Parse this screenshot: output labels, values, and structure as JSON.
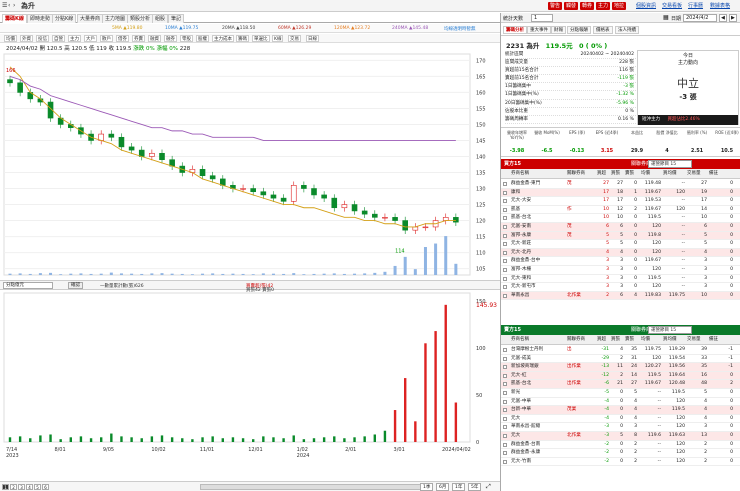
{
  "app": {
    "title": "為升",
    "nav_icons": [
      "menu-icon",
      "back-icon",
      "forward-icon"
    ]
  },
  "top_actions": [
    {
      "label": "警告",
      "color": "#c00"
    },
    {
      "label": "觸發",
      "color": "#c00"
    },
    {
      "label": "轉券",
      "color": "#c00"
    },
    {
      "label": "主力",
      "color": "#c00"
    },
    {
      "label": "地拉",
      "color": "#c00"
    }
  ],
  "top_links": [
    "個股資訊",
    "交易看板",
    "行事曆",
    "數據表格"
  ],
  "tabs": [
    "籌碼K線",
    "即時走勢",
    "分點K線",
    "大量券商",
    "主力地圖",
    "類股分析",
    "組股",
    "筆記"
  ],
  "ma_legend": [
    {
      "label": "5MA ▲119.80",
      "color": "#d4a017"
    },
    {
      "label": "10MA ▲119.75",
      "color": "#2a7fd4"
    },
    {
      "label": "20MA ▲118.50",
      "color": "#444"
    },
    {
      "label": "60MA ▲126.29",
      "color": "#c0392b"
    },
    {
      "label": "120MA ▲123.72",
      "color": "#e67e22"
    },
    {
      "label": "240MA ▲145.48",
      "color": "#9b59b6"
    }
  ],
  "ma_note": "均線透明時暫無",
  "toolbar": [
    "均價",
    "外資",
    "投信",
    "自營",
    "主力",
    "大戶",
    "散戶",
    "借券",
    "券賣",
    "融資",
    "融券",
    "零股",
    "股權",
    "主力成本",
    "籌碼",
    "單邊比",
    "K線",
    "交易",
    "日",
    "週",
    "月",
    "年",
    "還原",
    "切換",
    "日線"
  ],
  "info_line": {
    "date": "2024/04/02",
    "open_label": "開",
    "open": "120.5",
    "high_label": "高",
    "high": "120.5",
    "low_label": "低",
    "low": "119",
    "close_label": "收",
    "close": "119.5",
    "chg_label": "漲跌",
    "chg": "0%",
    "chg_pct_label": "漲幅",
    "chg_pct": "0%",
    "vol": "228"
  },
  "price_axis": [
    "170",
    "165",
    "160",
    "155",
    "150",
    "145",
    "140",
    "135",
    "130",
    "125",
    "120",
    "115",
    "110",
    "105"
  ],
  "price_marks": {
    "hi": "166",
    "lo": "114"
  },
  "indicator_bar": {
    "select": "分點億元",
    "button": "確認",
    "legend1": "一數量累計數(張)626",
    "legend2": "買賣超(張)42",
    "legend3": "買張42 賣張0"
  },
  "volume_axis": [
    "150",
    "100",
    "50",
    "0"
  ],
  "volume_marker": "145.93",
  "x_axis": [
    "7/14\n2023",
    "8/01",
    "9/05",
    "10/02",
    "11/01",
    "12/01",
    "1/02\n2024",
    "2/01",
    "3/01",
    "2024/04/02"
  ],
  "pager": [
    "1",
    "2",
    "3",
    "4",
    "5",
    "6"
  ],
  "ranges": [
    "1季",
    "6月",
    "1年",
    "5年"
  ],
  "chart_data": {
    "type": "candlestick",
    "ylim": [
      103,
      172
    ],
    "ma_series": [
      {
        "name": "5MA",
        "values": [
          168,
          165,
          160,
          158,
          155,
          152,
          150,
          148,
          146,
          145,
          144,
          142,
          141,
          140,
          139,
          138,
          137,
          136,
          135,
          133,
          132,
          131,
          130,
          129,
          128,
          127,
          126,
          125,
          125,
          124,
          124,
          123,
          122,
          121,
          121,
          120,
          120,
          119,
          119,
          118,
          118,
          119,
          119,
          120,
          120
        ]
      },
      {
        "name": "240MA",
        "values": [
          165,
          164,
          162,
          161,
          159,
          158,
          157,
          156,
          155,
          154,
          153,
          152,
          151,
          150,
          149,
          149,
          148,
          148,
          147,
          147,
          146,
          146,
          146,
          146,
          146,
          145,
          145,
          145,
          145,
          145,
          145,
          145,
          145,
          145,
          145,
          145,
          145,
          145,
          145,
          145,
          145,
          145,
          145,
          145,
          145
        ]
      }
    ],
    "closes": [
      163,
      160,
      158,
      157,
      152,
      150,
      149,
      147,
      145,
      147,
      146,
      143,
      142,
      140,
      141,
      139,
      137,
      135,
      136,
      134,
      133,
      131,
      130,
      130,
      129,
      128,
      127,
      126,
      131,
      130,
      128,
      127,
      124,
      125,
      123,
      122,
      121,
      121,
      120,
      117,
      118,
      118,
      120,
      121,
      119.5
    ],
    "volume_bars": [
      5,
      6,
      4,
      7,
      8,
      3,
      5,
      6,
      4,
      5,
      9,
      6,
      5,
      4,
      6,
      7,
      5,
      4,
      3,
      5,
      6,
      4,
      5,
      4,
      3,
      6,
      5,
      4,
      7,
      3,
      4,
      5,
      6,
      4,
      5,
      6,
      8,
      12,
      34,
      68,
      22,
      105,
      118,
      145.93,
      42
    ]
  },
  "right_panel": {
    "top_select_label": "統計天數",
    "top_select_value": "1",
    "date_label": "日期",
    "date_value": "2024/4/2",
    "tabs": [
      "籌碼分析",
      "重大事件",
      "財報",
      "分點報酬",
      "價格表",
      "法人持續"
    ],
    "stock_name": "2231 為升",
    "price": "119.5元",
    "change": "0 ( 0% )",
    "stats": [
      {
        "k": "統計區間",
        "v": "20240402 ~ 20240402"
      },
      {
        "k": "區間成交量",
        "v": "228 張"
      },
      {
        "k": "買超前15名合計",
        "v": "116 張"
      },
      {
        "k": "賣超前15名合計",
        "v": "-119 張"
      },
      {
        "k": "1日籌碼集中",
        "v": "-3 張"
      },
      {
        "k": "1日籌碼集中(%)",
        "v": "-1.32 %"
      },
      {
        "k": "20日籌碼集中(%)",
        "v": "-5.96 %"
      },
      {
        "k": "佔股本比重",
        "v": "0 %"
      },
      {
        "k": "籌碼周轉率",
        "v": "0.16 %"
      }
    ],
    "main_force": {
      "title_top": "今日",
      "title_sub": "主力動向",
      "state": "中立",
      "amount": "-3 張",
      "foot_label": "短沖主力",
      "foot_value": "買超佔比2.46%"
    },
    "metrics": [
      {
        "l": "營收年增率 YoY(%)",
        "v": "-3.98",
        "c": "neg"
      },
      {
        "l": "營收 MoM(%)",
        "v": "-6.5",
        "c": "neg"
      },
      {
        "l": "EPS (季)",
        "v": "-0.13",
        "c": "neg"
      },
      {
        "l": "EPS (近4季)",
        "v": "3.15",
        "c": "pos"
      },
      {
        "l": "本益比",
        "v": "29.9",
        "c": ""
      },
      {
        "l": "股價 淨值比",
        "v": "4",
        "c": ""
      },
      {
        "l": "殖利率 (%)",
        "v": "2.51",
        "c": ""
      },
      {
        "l": "ROE (近4季)",
        "v": "10.5",
        "c": ""
      }
    ],
    "buy_header": {
      "title": "買方15",
      "lab": "關聯券商",
      "select": "運營節目 15"
    },
    "sell_header": {
      "title": "賣方15",
      "lab": "關聯券商",
      "select": "運營節目 15"
    },
    "columns": [
      "券商名稱",
      "關聯券商",
      "買超",
      "買張",
      "賣張",
      "均價",
      "買均價",
      "交易量",
      "備註"
    ],
    "buy_rows": [
      {
        "n": "群益金鼎-東門",
        "r": "茂",
        "net": "27",
        "b": "27",
        "s": "0",
        "avg": "119.48",
        "bavg": "--",
        "vol": "27",
        "x": "0",
        "hl": false
      },
      {
        "n": "康和",
        "r": "",
        "net": "17",
        "b": "18",
        "s": "1",
        "avg": "119.67",
        "bavg": "120",
        "vol": "19",
        "x": "0",
        "hl": true
      },
      {
        "n": "元大-大安",
        "r": "",
        "net": "17",
        "b": "17",
        "s": "0",
        "avg": "119.53",
        "bavg": "--",
        "vol": "17",
        "x": "0",
        "hl": false
      },
      {
        "n": "凱基",
        "r": "作",
        "net": "10",
        "b": "12",
        "s": "2",
        "avg": "119.67",
        "bavg": "120",
        "vol": "14",
        "x": "0",
        "hl": false
      },
      {
        "n": "凱基-台北",
        "r": "",
        "net": "10",
        "b": "10",
        "s": "0",
        "avg": "119.5",
        "bavg": "--",
        "vol": "10",
        "x": "0",
        "hl": false
      },
      {
        "n": "元富-安南",
        "r": "茂",
        "net": "6",
        "b": "6",
        "s": "0",
        "avg": "120",
        "bavg": "--",
        "vol": "6",
        "x": "0",
        "hl": true
      },
      {
        "n": "富邦-永康",
        "r": "茂",
        "net": "5",
        "b": "5",
        "s": "0",
        "avg": "119.8",
        "bavg": "--",
        "vol": "5",
        "x": "0",
        "hl": true
      },
      {
        "n": "元大-新莊",
        "r": "",
        "net": "5",
        "b": "5",
        "s": "0",
        "avg": "120",
        "bavg": "--",
        "vol": "5",
        "x": "0",
        "hl": false
      },
      {
        "n": "元大-北丹",
        "r": "",
        "net": "4",
        "b": "4",
        "s": "0",
        "avg": "120",
        "bavg": "--",
        "vol": "4",
        "x": "0",
        "hl": true
      },
      {
        "n": "群益金鼎-台中",
        "r": "",
        "net": "3",
        "b": "3",
        "s": "0",
        "avg": "119.67",
        "bavg": "--",
        "vol": "3",
        "x": "0",
        "hl": false
      },
      {
        "n": "富邦-木柵",
        "r": "",
        "net": "3",
        "b": "3",
        "s": "0",
        "avg": "120",
        "bavg": "--",
        "vol": "3",
        "x": "0",
        "hl": false
      },
      {
        "n": "元大-東和",
        "r": "",
        "net": "3",
        "b": "3",
        "s": "0",
        "avg": "119.5",
        "bavg": "--",
        "vol": "3",
        "x": "0",
        "hl": false
      },
      {
        "n": "元大-新屯市",
        "r": "",
        "net": "3",
        "b": "3",
        "s": "0",
        "avg": "120",
        "bavg": "--",
        "vol": "3",
        "x": "0",
        "hl": false
      },
      {
        "n": "華南永昌",
        "r": "北作業",
        "net": "2",
        "b": "6",
        "s": "4",
        "avg": "119.83",
        "bavg": "119.75",
        "vol": "10",
        "x": "0",
        "hl": true
      }
    ],
    "sell_rows": [
      {
        "n": "台灣摩根士丹利",
        "r": "出",
        "net": "-31",
        "b": "4",
        "s": "35",
        "avg": "119.75",
        "bavg": "119.29",
        "vol": "39",
        "x": "-1",
        "hl": false
      },
      {
        "n": "元富-成美",
        "r": "",
        "net": "-29",
        "b": "2",
        "s": "31",
        "avg": "120",
        "bavg": "119.54",
        "vol": "33",
        "x": "-1",
        "hl": false
      },
      {
        "n": "新加坡商瑞銀",
        "r": "出作業",
        "net": "-13",
        "b": "11",
        "s": "24",
        "avg": "120.27",
        "bavg": "119.56",
        "vol": "35",
        "x": "-1",
        "hl": true
      },
      {
        "n": "元大-紅",
        "r": "",
        "net": "-12",
        "b": "2",
        "s": "14",
        "avg": "119.5",
        "bavg": "119.64",
        "vol": "16",
        "x": "0",
        "hl": true
      },
      {
        "n": "凱基-台北",
        "r": "出作業",
        "net": "-6",
        "b": "21",
        "s": "27",
        "avg": "119.67",
        "bavg": "120.48",
        "vol": "48",
        "x": "2",
        "hl": true
      },
      {
        "n": "新光",
        "r": "",
        "net": "-5",
        "b": "0",
        "s": "5",
        "avg": "--",
        "bavg": "119.5",
        "vol": "5",
        "x": "0",
        "hl": false
      },
      {
        "n": "元富-中華",
        "r": "",
        "net": "-4",
        "b": "0",
        "s": "4",
        "avg": "--",
        "bavg": "120",
        "vol": "4",
        "x": "0",
        "hl": false
      },
      {
        "n": "台新-中華",
        "r": "茂業",
        "net": "-4",
        "b": "0",
        "s": "4",
        "avg": "--",
        "bavg": "119.5",
        "vol": "4",
        "x": "0",
        "hl": true
      },
      {
        "n": "元大",
        "r": "",
        "net": "-4",
        "b": "0",
        "s": "4",
        "avg": "--",
        "bavg": "120",
        "vol": "4",
        "x": "0",
        "hl": false
      },
      {
        "n": "華南永昌-館總",
        "r": "",
        "net": "-3",
        "b": "0",
        "s": "3",
        "avg": "--",
        "bavg": "120",
        "vol": "3",
        "x": "0",
        "hl": false
      },
      {
        "n": "元大",
        "r": "北作業",
        "net": "-3",
        "b": "5",
        "s": "8",
        "avg": "119.6",
        "bavg": "119.63",
        "vol": "13",
        "x": "0",
        "hl": true
      },
      {
        "n": "群益金鼎-台南",
        "r": "",
        "net": "-2",
        "b": "0",
        "s": "2",
        "avg": "--",
        "bavg": "120",
        "vol": "2",
        "x": "0",
        "hl": false
      },
      {
        "n": "群益金鼎-永康",
        "r": "",
        "net": "-2",
        "b": "0",
        "s": "2",
        "avg": "--",
        "bavg": "120",
        "vol": "2",
        "x": "0",
        "hl": false
      },
      {
        "n": "元大-竹南",
        "r": "",
        "net": "-2",
        "b": "0",
        "s": "2",
        "avg": "--",
        "bavg": "120",
        "vol": "2",
        "x": "0",
        "hl": false
      }
    ]
  }
}
